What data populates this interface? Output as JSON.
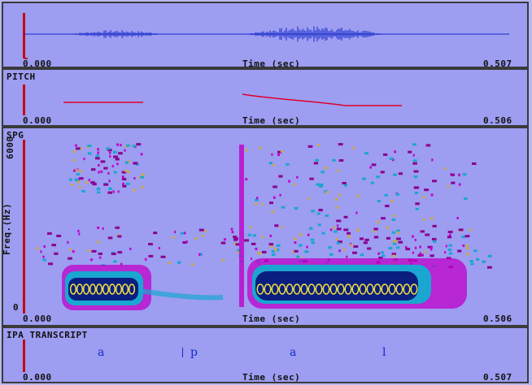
{
  "panels": {
    "waveform": {
      "x_start": "0.000",
      "x_label": "Time (sec)",
      "x_end": "0.507"
    },
    "pitch": {
      "title": "PITCH",
      "x_start": "0.000",
      "x_label": "Time (sec)",
      "x_end": "0.506"
    },
    "spectrogram": {
      "title": "SPG",
      "y_label": "Freq.(Hz)",
      "y_top": "6000",
      "y_bottom": "0",
      "x_start": "0.000",
      "x_label": "Time (sec)",
      "x_end": "0.506"
    },
    "transcript": {
      "title": "IPA TRANSCRIPT",
      "x_start": "0.000",
      "x_label": "Time (sec)",
      "x_end": "0.507",
      "segments": [
        "a",
        "p",
        "a",
        "l"
      ]
    }
  },
  "colors": {
    "panel_bg": "#9d9df2",
    "axis": "#c80014",
    "wave": "#1428c8",
    "pitch": "#e0002a"
  }
}
